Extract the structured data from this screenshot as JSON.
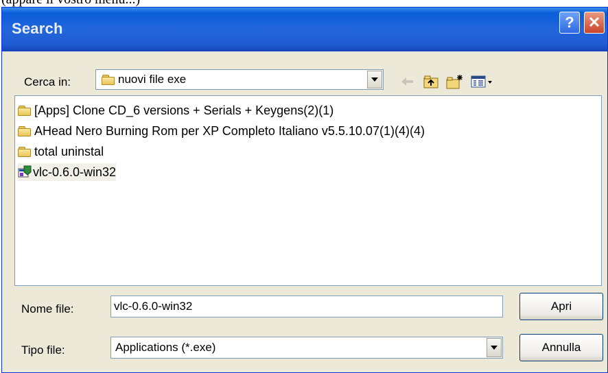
{
  "caption": "(appare il vostro menu...)",
  "window": {
    "title": "Search"
  },
  "titlebar_buttons": {
    "help": "?",
    "close": "✕"
  },
  "lookin": {
    "label": "Cerca in:",
    "value": "nuovi file exe"
  },
  "toolbar": {
    "back_icon": "back-arrow-icon",
    "up_icon": "up-folder-icon",
    "new_folder_icon": "new-folder-icon",
    "view_icon": "view-menu-icon"
  },
  "files": [
    {
      "name": "[Apps] Clone CD_6 versions + Serials + Keygens(2)(1)",
      "type": "folder"
    },
    {
      "name": "AHead Nero Burning Rom per XP Completo Italiano v5.5.10.07(1)(4)(4)",
      "type": "folder"
    },
    {
      "name": "total uninstal",
      "type": "folder"
    },
    {
      "name": "vlc-0.6.0-win32",
      "type": "exe",
      "selected": true
    }
  ],
  "filename": {
    "label": "Nome file:",
    "value": "vlc-0.6.0-win32"
  },
  "filetype": {
    "label": "Tipo file:",
    "value": "Applications (*.exe)"
  },
  "buttons": {
    "open": "Apri",
    "cancel": "Annulla"
  },
  "colors": {
    "titlebar": "#1F5BD1",
    "dialog_bg": "#ECE9D8",
    "field_border": "#7F9DB9"
  }
}
